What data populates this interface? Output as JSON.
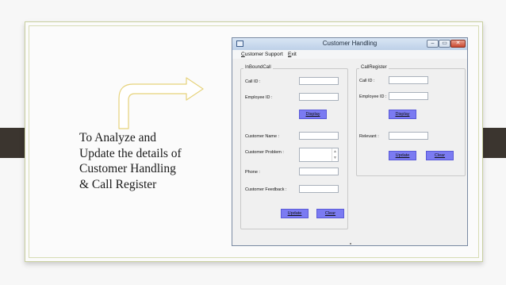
{
  "caption": {
    "lines": [
      "To Analyze and",
      "Update the details of",
      "Customer Handling",
      "& Call Register"
    ]
  },
  "window": {
    "title": "Customer Handling",
    "controls": {
      "minimize": "–",
      "maximize": "▭",
      "close": "✕"
    }
  },
  "menu": {
    "items": [
      {
        "mnemonic": "C",
        "rest": "ustomer Support"
      },
      {
        "mnemonic": "E",
        "rest": "xit"
      }
    ]
  },
  "inbound": {
    "legend": "InBoundCall",
    "call_id_label": "Call ID :",
    "employee_id_label": "Employee ID :",
    "display_button": "Display",
    "customer_name_label": "Customer Name :",
    "customer_problem_label": "Customer Problem :",
    "phone_label": "Phone :",
    "customer_feedback_label": "Customer Feedback :",
    "update_button": "Update",
    "clear_button": "Clear"
  },
  "callregister": {
    "legend": "CallRegister",
    "call_id_label": "Call ID :",
    "employee_id_label": "Employee ID :",
    "display_button": "Display",
    "relevant_label": "Relevant :",
    "update_button": "Update",
    "clear_button": "Clear"
  },
  "colors": {
    "button_fill": "#7b7bf2",
    "side_tab": "#3b352f",
    "arrow_stroke": "#e6d27a"
  },
  "icons": {
    "arrow": "bent-arrow-right-icon",
    "scroll_up": "▲",
    "scroll_down": "▼"
  }
}
